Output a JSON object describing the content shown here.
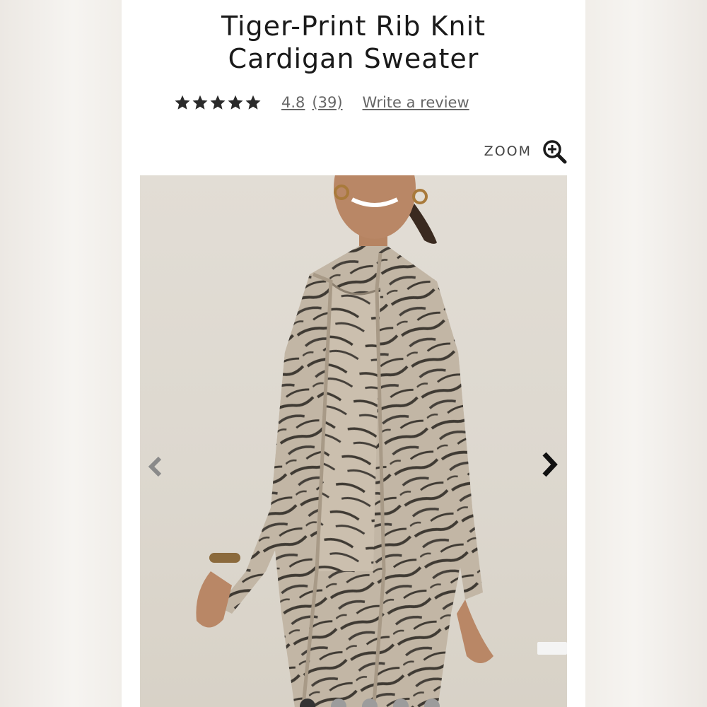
{
  "product": {
    "title_line1": "Tiger-Print Rib Knit",
    "title_line2": "Cardigan Sweater"
  },
  "rating": {
    "stars": 5,
    "value": "4.8",
    "count": "(39)",
    "write_review": "Write a review"
  },
  "zoom": {
    "label": "ZOOM",
    "icon": "zoom-in-icon"
  },
  "gallery": {
    "prev_icon": "chevron-left-icon",
    "next_icon": "chevron-right-icon"
  },
  "colors": {
    "star": "#2a2a2a",
    "text": "#1a1a1a",
    "link": "#666666",
    "photo_bg": "#e0dbd3",
    "cardigan": "#bfb2a1",
    "stripe": "#3f3a33"
  }
}
